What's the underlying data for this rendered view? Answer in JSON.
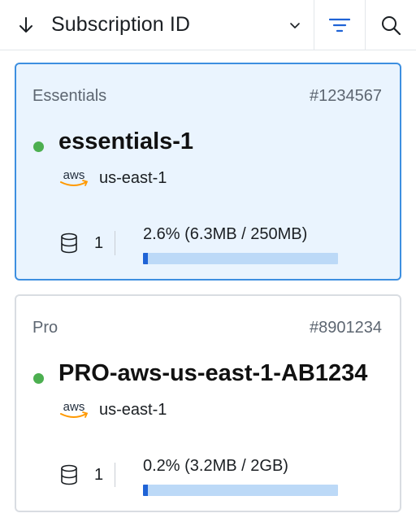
{
  "toolbar": {
    "sort_label": "Subscription ID",
    "sort_direction_icon": "arrow-down-icon",
    "dropdown_icon": "chevron-down-icon",
    "filter_icon": "filter-icon",
    "search_icon": "search-icon"
  },
  "subscriptions": [
    {
      "plan": "Essentials",
      "id": "#1234567",
      "status": "active",
      "status_color": "#4caf50",
      "name": "essentials-1",
      "provider_logo": "aws",
      "region": "us-east-1",
      "db_count": "1",
      "usage_text": "2.6% (6.3MB / 250MB)",
      "usage_percent": 2.6,
      "selected": true
    },
    {
      "plan": "Pro",
      "id": "#8901234",
      "status": "active",
      "status_color": "#4caf50",
      "name": "PRO-aws-us-east-1-AB1234",
      "provider_logo": "aws",
      "region": "us-east-1",
      "db_count": "1",
      "usage_text": "0.2% (3.2MB / 2GB)",
      "usage_percent": 0.2,
      "selected": false
    }
  ],
  "colors": {
    "selected_border": "#3d8fe0",
    "selected_bg": "#eaf4fe",
    "usage_track": "#bcd9f7",
    "usage_fill": "#1f63d6"
  }
}
